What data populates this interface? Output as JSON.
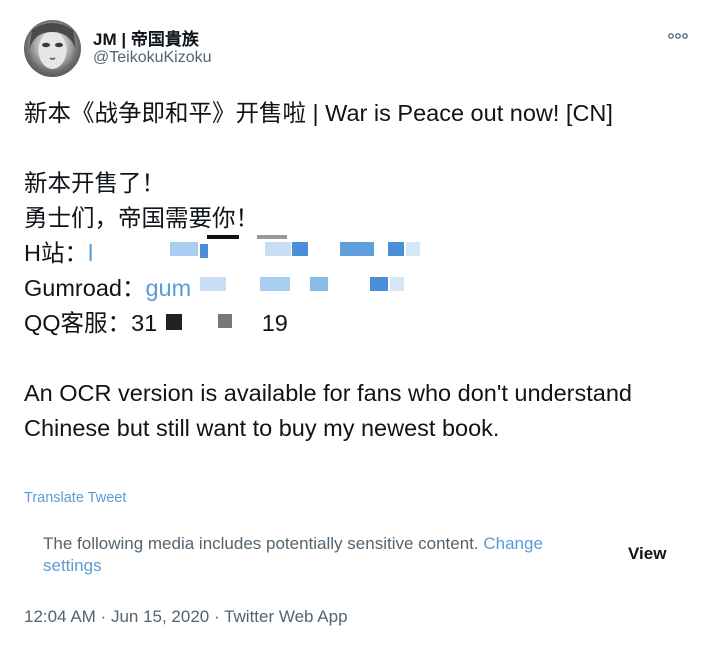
{
  "author": {
    "display_name": "JM | 帝国貴族",
    "handle": "@TeikokuKizoku",
    "avatar_icon": "avatar-portrait"
  },
  "menu": {
    "icon": "more-horizontal-icon"
  },
  "tweet": {
    "title_line": "新本《战争即和平》开售啦 | War is Peace out now! [CN]",
    "line_2": "新本开售了！",
    "line_3": "勇士们，帝国需要你！",
    "h_label": "H站：",
    "h_link_visible": "l",
    "gumroad_label": "Gumroad：",
    "gumroad_link_visible": "gum",
    "qq_label": "QQ客服：",
    "qq_prefix": "31",
    "qq_suffix": "19",
    "ocr_paragraph": "An OCR version is available for fans who don't understand Chinese but still want to  buy my newest book."
  },
  "translate_label": "Translate Tweet",
  "sensitive": {
    "message": "The following media includes potentially sensitive content. ",
    "change_settings": "Change settings",
    "view_label": "View"
  },
  "meta": {
    "time": "12:04 AM",
    "date": "Jun 15, 2020",
    "source": "Twitter Web App",
    "separator": " · "
  },
  "colors": {
    "link": "#5b9bd5",
    "text": "#0f1419",
    "secondary": "#536471"
  }
}
